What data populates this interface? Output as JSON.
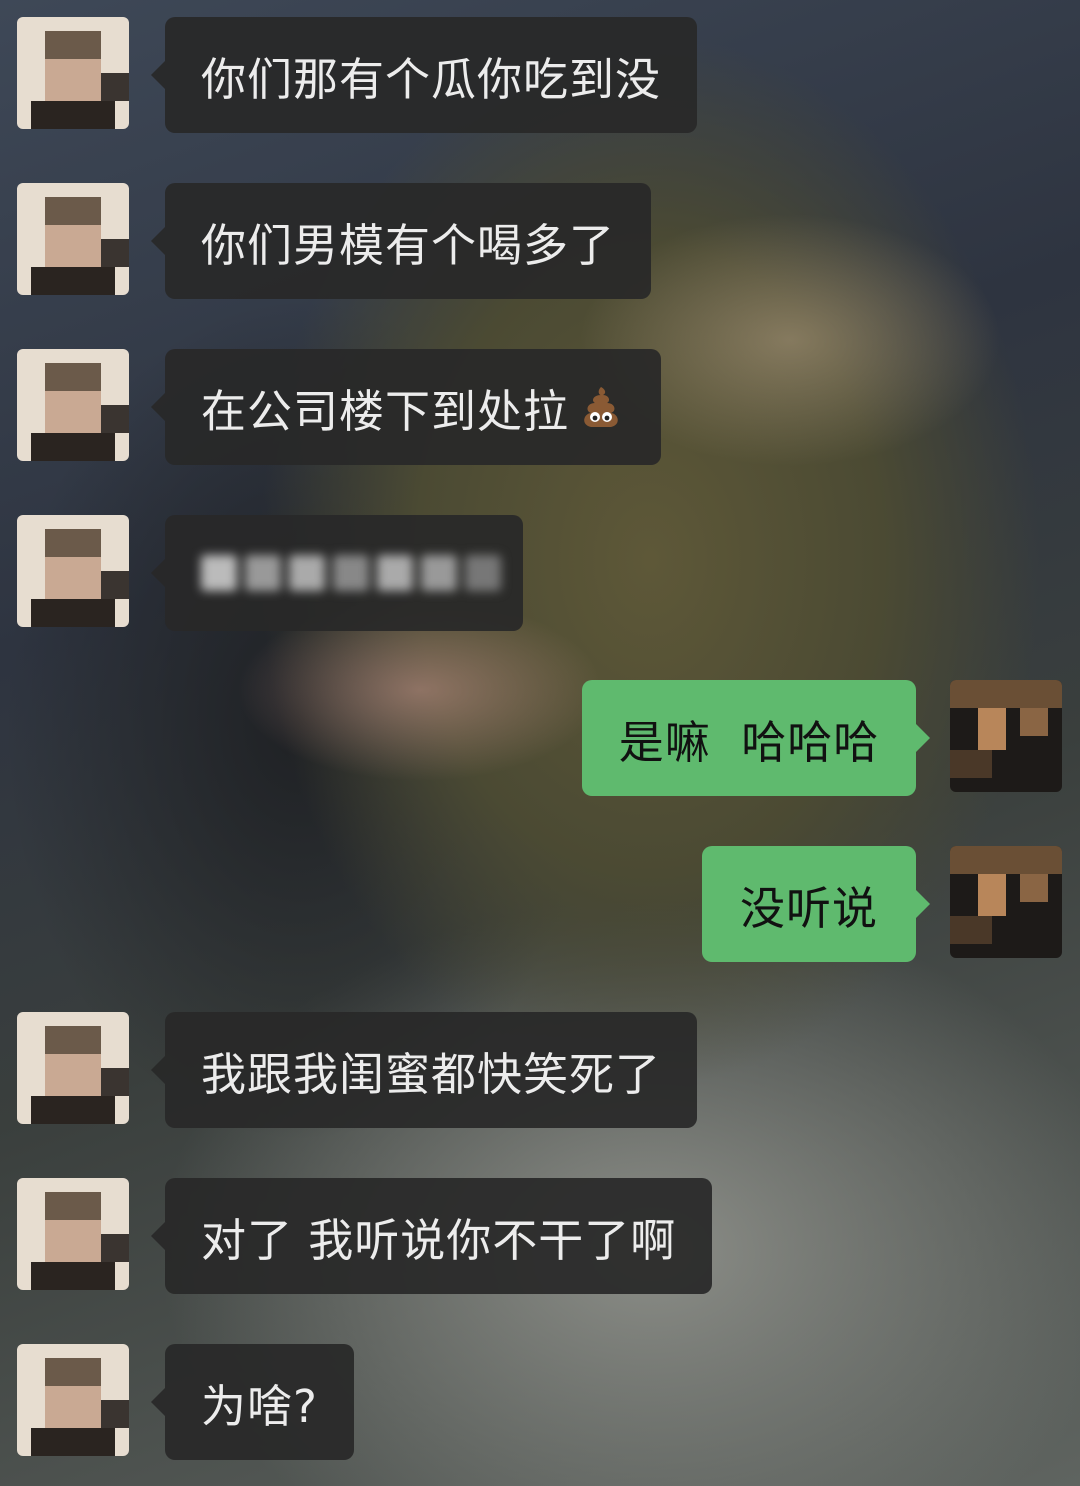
{
  "chat": {
    "messages": [
      {
        "side": "in",
        "text": "你们那有个瓜你吃到没"
      },
      {
        "side": "in",
        "text": "你们男模有个喝多了"
      },
      {
        "side": "in",
        "text": "在公司楼下到处拉",
        "emoji": "poop-emoji"
      },
      {
        "side": "in",
        "text": "",
        "blurred": true
      },
      {
        "side": "out",
        "text": "是嘛  哈哈哈"
      },
      {
        "side": "out",
        "text": "没听说"
      },
      {
        "side": "in",
        "text": "我跟我闺蜜都快笑死了"
      },
      {
        "side": "in",
        "text": "对了 我听说你不干了啊"
      },
      {
        "side": "in",
        "text": "为啥?"
      }
    ]
  },
  "colors": {
    "incoming_bubble": "#282828",
    "outgoing_bubble": "#5fba6e",
    "incoming_text": "#ececec",
    "outgoing_text": "#111111"
  },
  "icons": {
    "contact_avatar": "pixelated-portrait-avatar",
    "self_avatar": "pixelated-photo-avatar",
    "emoji": "poop-emoji"
  }
}
